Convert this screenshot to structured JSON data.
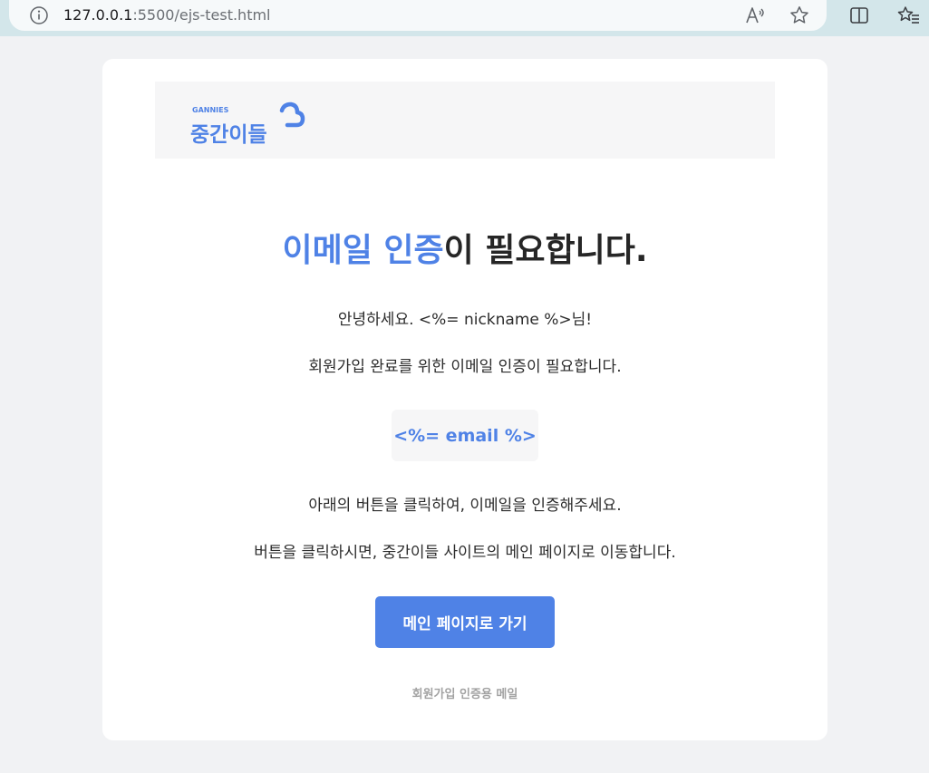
{
  "browser": {
    "url_host": "127.0.0.1",
    "url_rest": ":5500/ejs-test.html",
    "icons": [
      "info-icon",
      "read-aloud-icon",
      "favorite-star-icon",
      "split-screen-icon",
      "favorites-list-icon"
    ]
  },
  "logo": {
    "brand_en": "GANNIES",
    "brand_ko": "중간이들",
    "accent_color": "#4f82e6"
  },
  "mail": {
    "headline_accent": "이메일 인증",
    "headline_rest": "이 필요합니다.",
    "greeting": "안녕하세요. <%= nickname %>님!",
    "intro": "회원가입 완료를 위한 이메일 인증이 필요합니다.",
    "email_placeholder": "<%= email %>",
    "instruction": "아래의 버튼을 클릭하여, 이메일을 인증해주세요.",
    "redirect_note": "버튼을 클릭하시면, 중간이들 사이트의 메인 페이지로 이동합니다.",
    "button_label": "메인 페이지로 가기",
    "footer": "회원가입 인증용 메일"
  },
  "colors": {
    "accent": "#4f82e6",
    "page_bg": "#f1f2f4",
    "card_bg": "#ffffff",
    "browser_bar": "#d3e6ea"
  }
}
